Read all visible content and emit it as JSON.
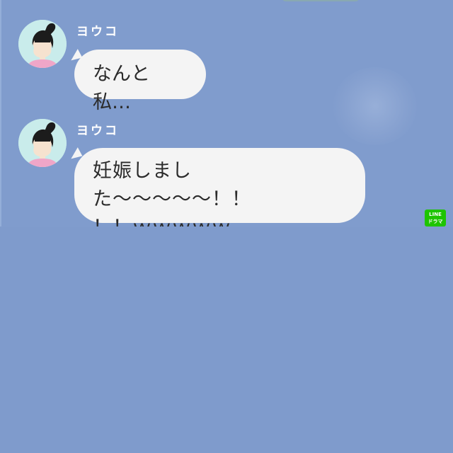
{
  "chat": {
    "messages": [
      {
        "sender": "ヨウコ",
        "text": "なんと私…"
      },
      {
        "sender": "ヨウコ",
        "lines": [
          "妊娠しました〜〜〜〜〜！！",
          "！！ｗｗｗｗｗ"
        ]
      }
    ]
  },
  "watermark": {
    "line1": "LINE",
    "line2": "ドラマ"
  },
  "colors": {
    "chat_background": "#809ccd",
    "bubble": "#f4f4f4",
    "name_text": "#ffffff",
    "avatar_background": "#c9eceb",
    "avatar_hair": "#1c1c1c",
    "avatar_shirt": "#f0a6c8",
    "watermark": "#1ec400"
  },
  "icons": {
    "avatar": "woman-ponytail-avatar-icon",
    "watermark": "line-drama-logo-icon"
  }
}
